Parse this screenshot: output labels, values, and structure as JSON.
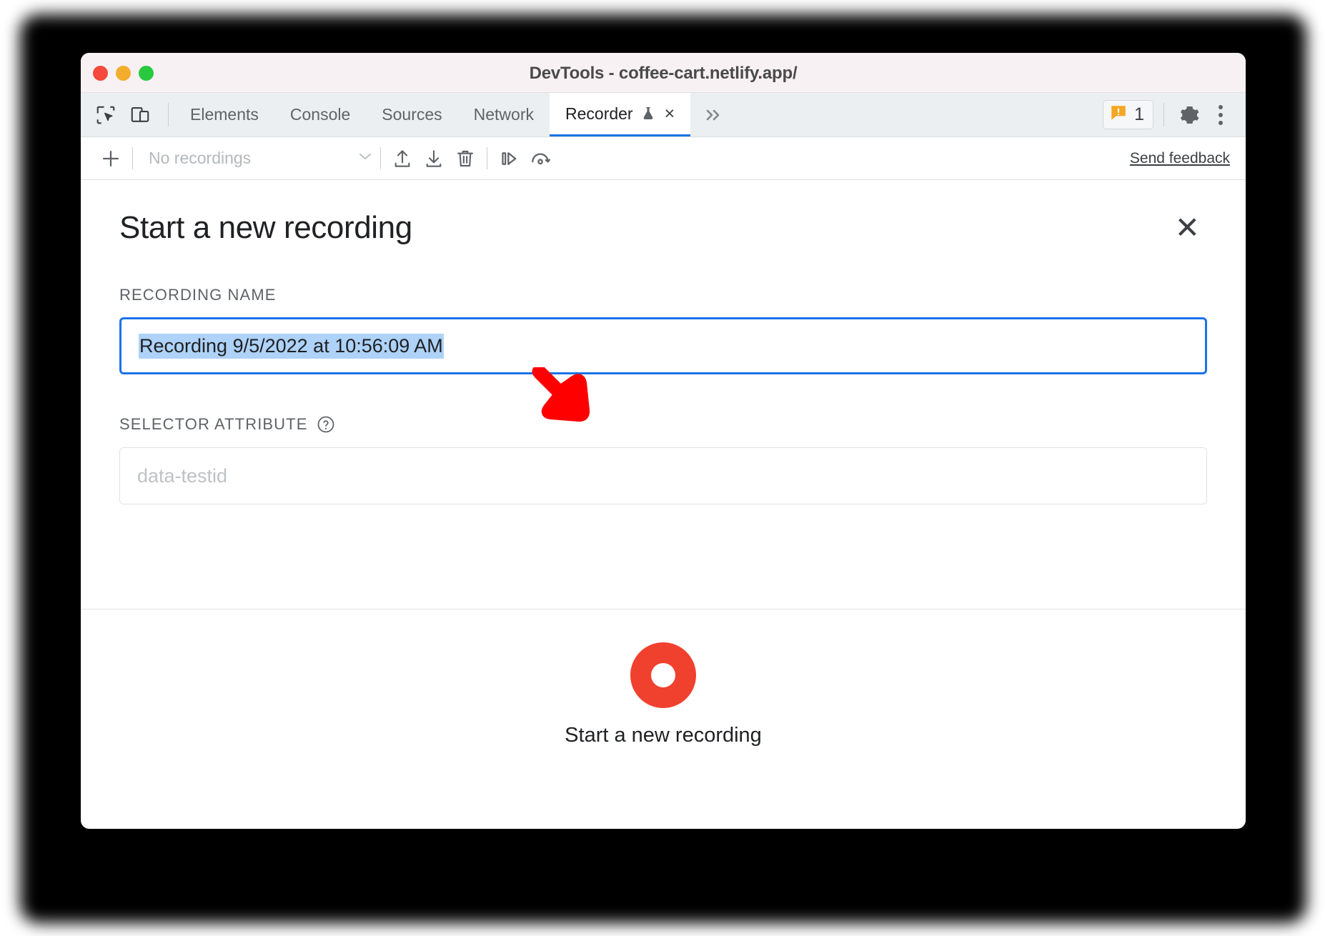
{
  "window": {
    "title": "DevTools - coffee-cart.netlify.app/",
    "traffic_lights": [
      "close",
      "minimize",
      "maximize"
    ],
    "colors": {
      "titlebar_bg": "#f7f1f4",
      "tabstrip_bg": "#eceff1",
      "accent_blue": "#1a73e8",
      "record_red": "#f0402e",
      "warning_orange": "#f5a623",
      "selection_blue": "#aed2f8",
      "annotation_red": "#ff0000"
    }
  },
  "tabstrip": {
    "tools": [
      {
        "name": "inspect-element-icon",
        "label": "Inspect element"
      },
      {
        "name": "device-toolbar-icon",
        "label": "Toggle device toolbar"
      }
    ],
    "tabs": [
      {
        "label": "Elements",
        "active": false
      },
      {
        "label": "Console",
        "active": false
      },
      {
        "label": "Sources",
        "active": false
      },
      {
        "label": "Network",
        "active": false
      },
      {
        "label": "Recorder",
        "active": true,
        "experimental": true,
        "closable": true
      }
    ],
    "overflow_label": "»",
    "close_glyph": "×",
    "warnings": {
      "count": "1",
      "icon": "warning-badge-icon"
    },
    "settings_icon": "gear-icon",
    "more_icon": "kebab-menu-icon"
  },
  "recorder_toolbar": {
    "add_label": "+",
    "recordings_select": {
      "value": "No recordings",
      "chevron": "⌄"
    },
    "actions": [
      {
        "name": "import-recording-icon",
        "label": "Import recording"
      },
      {
        "name": "export-recording-icon",
        "label": "Export recording"
      },
      {
        "name": "delete-recording-icon",
        "label": "Delete recording"
      },
      {
        "name": "step-over-icon",
        "label": "Step over"
      },
      {
        "name": "replay-speed-icon",
        "label": "Replay speed"
      }
    ],
    "feedback_link": "Send feedback"
  },
  "panel": {
    "title": "Start a new recording",
    "close_glyph": "✕",
    "fields": [
      {
        "label": "RECORDING NAME",
        "value": "Recording 9/5/2022 at 10:56:09 AM",
        "placeholder": "",
        "focused": true,
        "selected": true,
        "help": false
      },
      {
        "label": "SELECTOR ATTRIBUTE",
        "value": "",
        "placeholder": "data-testid",
        "focused": false,
        "selected": false,
        "help": true,
        "help_glyph": "?"
      }
    ],
    "footer": {
      "record_button_name": "start-recording-button",
      "label": "Start a new recording"
    }
  },
  "annotation": {
    "type": "arrow",
    "direction": "down-left",
    "color": "#ff0000",
    "points_at": "recording-name-input"
  }
}
